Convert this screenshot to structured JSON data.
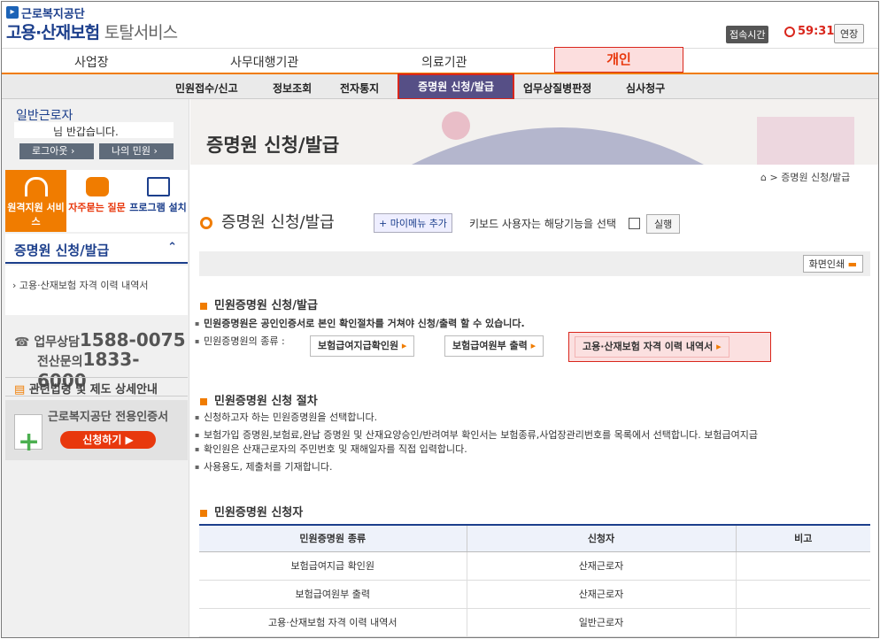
{
  "header": {
    "org_name": "근로복지공단",
    "service_name": "고용·산재보험",
    "service_suffix": "토탈서비스",
    "connection_label": "접속시간",
    "timer": "59:31",
    "extend_label": "연장"
  },
  "gnb": {
    "items": [
      "사업장",
      "사무대행기관",
      "의료기관",
      "개인"
    ]
  },
  "snb": {
    "items": [
      "민원접수/신고",
      "정보조회",
      "전자통지",
      "증명원 신청/발급",
      "업무상질병판정",
      "심사청구"
    ]
  },
  "sidebar": {
    "user_type": "일반근로자",
    "greeting": "님 반갑습니다.",
    "logout": "로그아웃",
    "my_requests": "나의 민원",
    "quick": [
      "원격지원 서비스",
      "자주묻는 질문",
      "프로그램 설치"
    ],
    "menu_title": "증명원 신청/발급",
    "menu_item": "고용·산재보험 자격 이력 내역서",
    "call_label1": "업무상담",
    "call_num1": "1588-0075",
    "call_label2": "전산문의",
    "call_num2": "1833-6000",
    "law_link": "관련법령 및 제도 상세안내",
    "cert_title": "근로복지공단 전용인증서",
    "cert_button": "신청하기"
  },
  "main": {
    "banner_title": "증명원 신청/발급",
    "breadcrumb": "> 증명원 신청/발급",
    "page_title": "증명원 신청/발급",
    "mymenu_add": "+ 마이메뉴 추가",
    "keyboard_text": "키보드 사용자는 해당기능을 선택",
    "run_button": "실행",
    "print_button": "화면인쇄",
    "sec1_title": "민원증명원 신청/발급",
    "sec1_bullet1": "민원증명원은 공인인증서로 본인 확인절차를 거쳐야 신청/출력 할 수 있습니다.",
    "sec1_bullet2": "민원증명원의 종류 :",
    "doc_buttons": [
      "보험급여지급확인원",
      "보험급여원부 출력",
      "고용·산재보험 자격 이력 내역서"
    ],
    "sec2_title": "민원증명원 신청 절차",
    "sec2_bullets": [
      "신청하고자 하는 민원증명원을 선택합니다.",
      "보험가입 증명원,보험료,완납 증명원 및 산재요양승인/반려여부 확인서는 보험종류,사업장관리번호를 목록에서 선택합니다. 보험급여지급",
      "확인원은 산재근로자의 주민번호 및 재해일자를 직접 입력합니다.",
      "사용용도, 제출처를 기재합니다."
    ],
    "sec3_title": "민원증명원 신청자",
    "table_headers": [
      "민원증명원 종류",
      "신청자",
      "비고"
    ],
    "table_rows": [
      [
        "보험급여지급 확인원",
        "산재근로자",
        ""
      ],
      [
        "보험급여원부 출력",
        "산재근로자",
        ""
      ],
      [
        "고용·산재보험 자격 이력 내역서",
        "일반근로자",
        ""
      ]
    ]
  },
  "colors": {
    "brand": "#1c3f8c",
    "accent": "#f07c00",
    "highlight": "#d9261c"
  }
}
